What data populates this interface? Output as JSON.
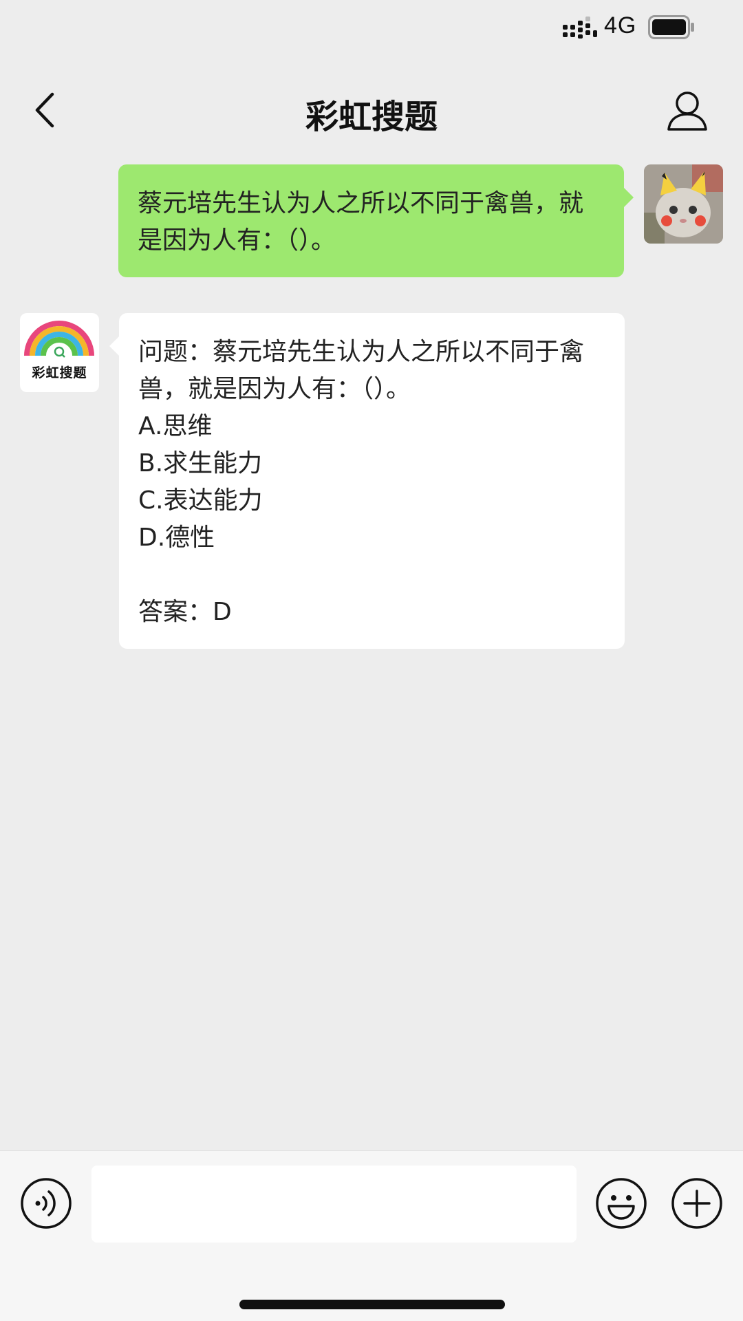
{
  "status_bar": {
    "network": "4G",
    "icons": [
      "signal-icon",
      "battery-icon"
    ]
  },
  "nav": {
    "title": "彩虹搜题",
    "back_icon": "chevron-left-icon",
    "profile_icon": "person-icon"
  },
  "messages": {
    "outgoing": {
      "text": "蔡元培先生认为人之所以不同于禽兽，就是因为人有：（）。",
      "avatar": "cat-photo-avatar"
    },
    "incoming": {
      "avatar_label": "彩虹搜题",
      "lines": [
        "问题：蔡元培先生认为人之所以不同于禽兽，就是因为人有：（）。",
        "A.思维",
        "B.求生能力",
        "C.表达能力",
        "D.德性",
        "",
        "答案：D"
      ]
    }
  },
  "input_bar": {
    "input_value": "",
    "icons": [
      "voice-icon",
      "emoji-icon",
      "plus-icon"
    ]
  },
  "colors": {
    "background": "#ededed",
    "outgoing_bubble": "#9de86f",
    "incoming_bubble": "#ffffff"
  }
}
